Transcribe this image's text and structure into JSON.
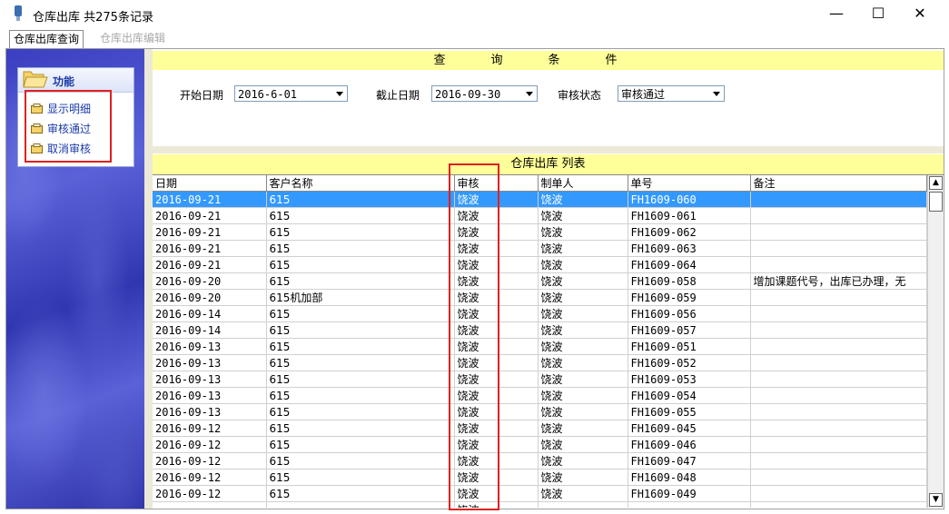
{
  "window": {
    "title": "仓库出库 共275条记录",
    "minimize": "—",
    "maximize": "☐",
    "close": "✕"
  },
  "tabs": [
    {
      "label": "仓库出库查询"
    },
    {
      "label": "仓库出库编辑"
    }
  ],
  "sidebar": {
    "title": "功能",
    "items": [
      {
        "label": "显示明细"
      },
      {
        "label": "审核通过"
      },
      {
        "label": "取消审核"
      }
    ]
  },
  "query": {
    "header": "查询条件",
    "start_label": "开始日期",
    "start_value": "2016-6-01",
    "end_label": "截止日期",
    "end_value": "2016-09-30",
    "status_label": "审核状态",
    "status_value": "审核通过"
  },
  "list": {
    "header": "仓库出库 列表",
    "columns": [
      "日期",
      "客户名称",
      "审核",
      "制单人",
      "单号",
      "备注"
    ],
    "rows": [
      [
        "2016-09-21",
        "615",
        "饶波",
        "饶波",
        "FH1609-060",
        ""
      ],
      [
        "2016-09-21",
        "615",
        "饶波",
        "饶波",
        "FH1609-061",
        ""
      ],
      [
        "2016-09-21",
        "615",
        "饶波",
        "饶波",
        "FH1609-062",
        ""
      ],
      [
        "2016-09-21",
        "615",
        "饶波",
        "饶波",
        "FH1609-063",
        ""
      ],
      [
        "2016-09-21",
        "615",
        "饶波",
        "饶波",
        "FH1609-064",
        ""
      ],
      [
        "2016-09-20",
        "615",
        "饶波",
        "饶波",
        "FH1609-058",
        "增加课题代号，出库已办理，无"
      ],
      [
        "2016-09-20",
        "615机加部",
        "饶波",
        "饶波",
        "FH1609-059",
        ""
      ],
      [
        "2016-09-14",
        "615",
        "饶波",
        "饶波",
        "FH1609-056",
        ""
      ],
      [
        "2016-09-14",
        "615",
        "饶波",
        "饶波",
        "FH1609-057",
        ""
      ],
      [
        "2016-09-13",
        "615",
        "饶波",
        "饶波",
        "FH1609-051",
        ""
      ],
      [
        "2016-09-13",
        "615",
        "饶波",
        "饶波",
        "FH1609-052",
        ""
      ],
      [
        "2016-09-13",
        "615",
        "饶波",
        "饶波",
        "FH1609-053",
        ""
      ],
      [
        "2016-09-13",
        "615",
        "饶波",
        "饶波",
        "FH1609-054",
        ""
      ],
      [
        "2016-09-13",
        "615",
        "饶波",
        "饶波",
        "FH1609-055",
        ""
      ],
      [
        "2016-09-12",
        "615",
        "饶波",
        "饶波",
        "FH1609-045",
        ""
      ],
      [
        "2016-09-12",
        "615",
        "饶波",
        "饶波",
        "FH1609-046",
        ""
      ],
      [
        "2016-09-12",
        "615",
        "饶波",
        "饶波",
        "FH1609-047",
        ""
      ],
      [
        "2016-09-12",
        "615",
        "饶波",
        "饶波",
        "FH1609-048",
        ""
      ],
      [
        "2016-09-12",
        "615",
        "饶波",
        "饶波",
        "FH1609-049",
        ""
      ],
      [
        "",
        "",
        "饶波",
        "",
        "",
        ""
      ]
    ],
    "selected_row": 0
  },
  "colors": {
    "selection": "#3399ff",
    "header_bar": "#ffff99",
    "highlight_box": "#e02020",
    "sidebar": "#3a3ec0"
  },
  "icons": [
    "app-icon",
    "folder-icon",
    "list-item-icon",
    "dropdown-arrow-icon",
    "scroll-up-icon",
    "scroll-down-icon"
  ]
}
